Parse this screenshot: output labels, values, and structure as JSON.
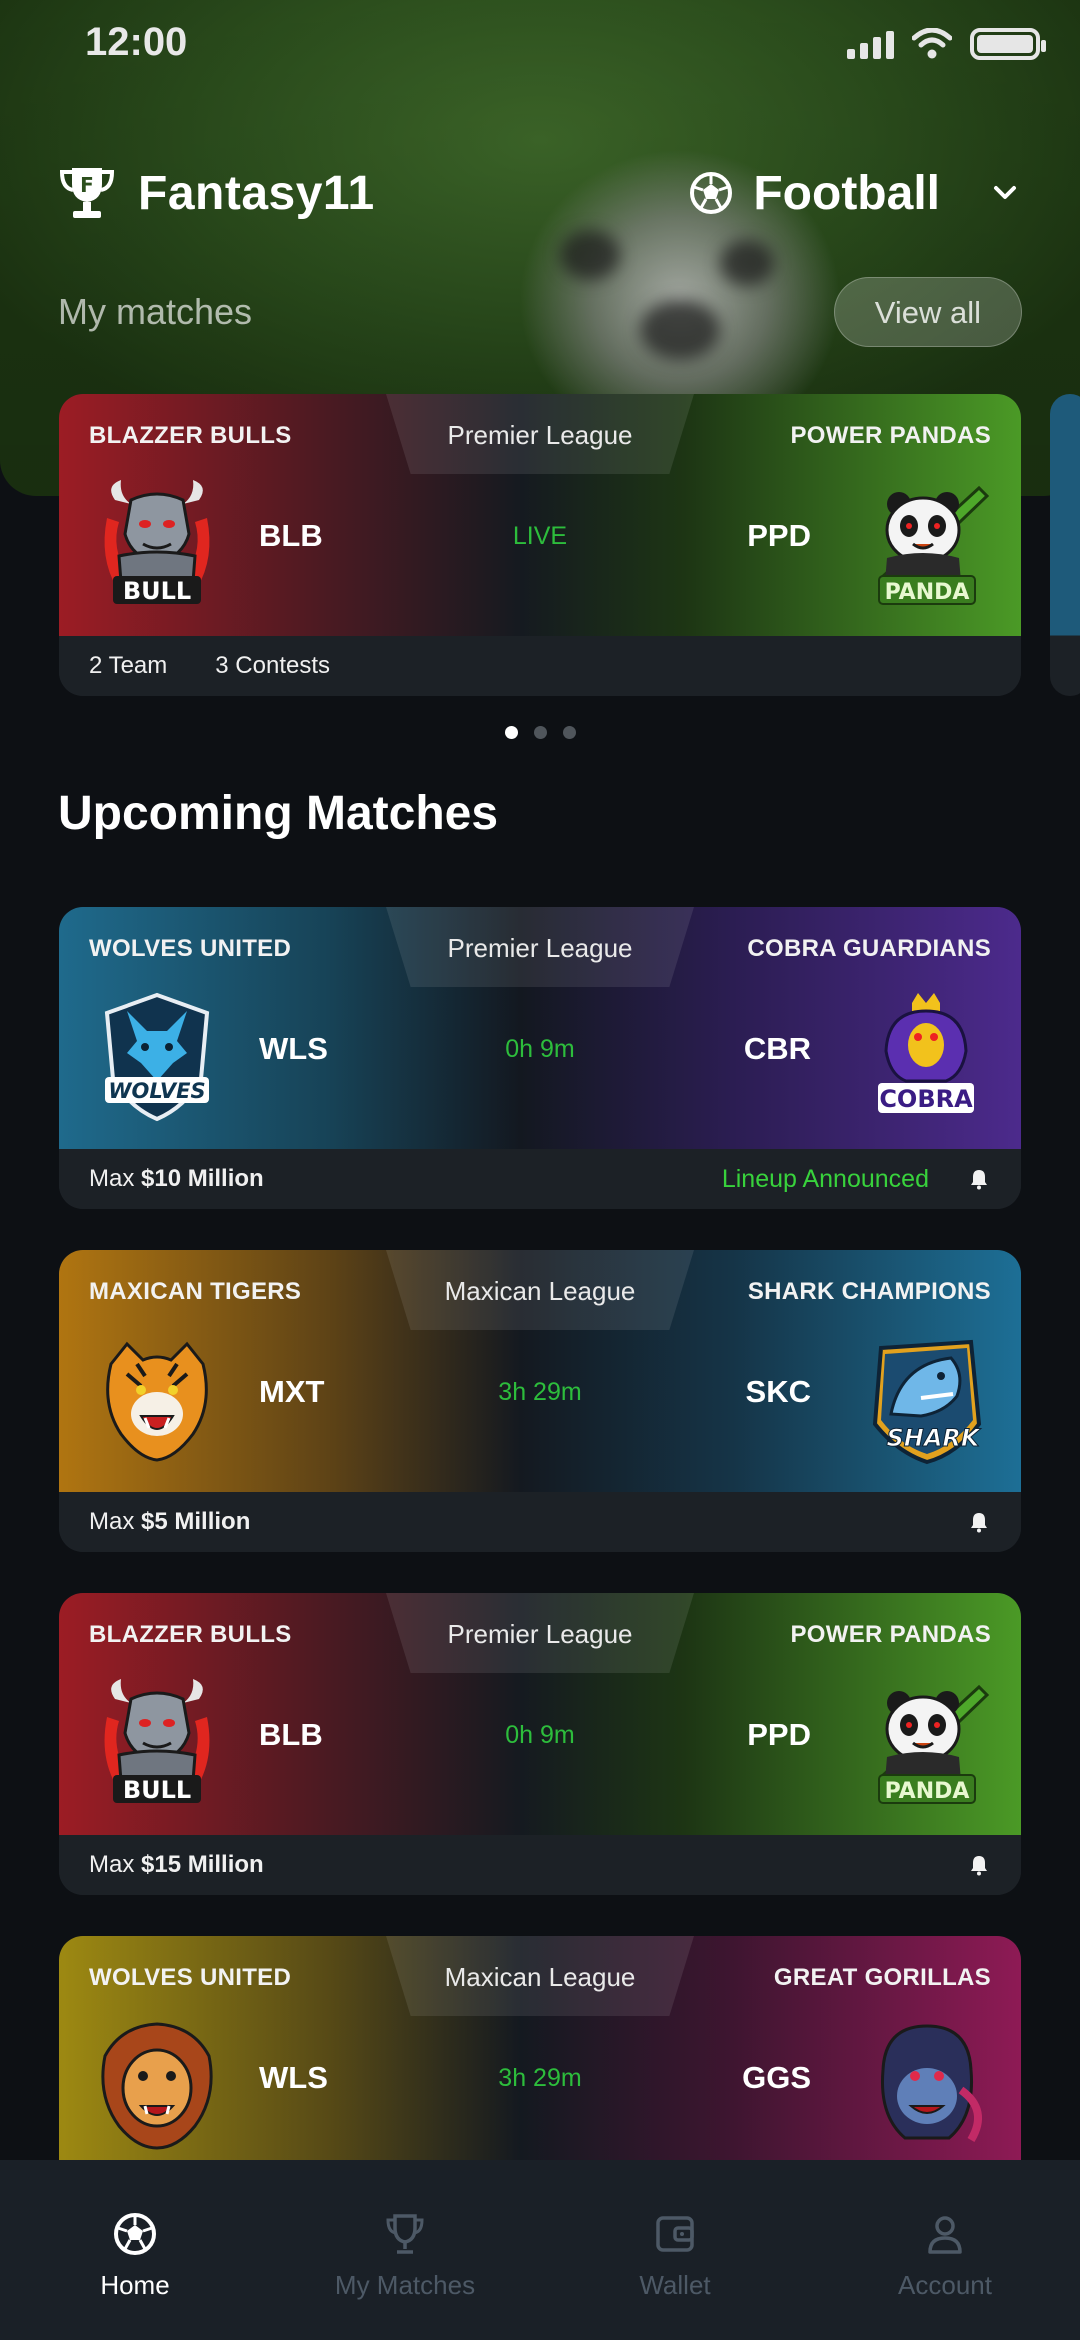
{
  "status_bar": {
    "time": "12:00"
  },
  "app": {
    "name": "Fantasy11",
    "sport": "Football"
  },
  "my_matches": {
    "title": "My matches",
    "view_all": "View all",
    "card": {
      "league": "Premier League",
      "team_left": {
        "name": "BLAZZER BULLS",
        "code": "BLB",
        "logo": "bull-logo"
      },
      "team_right": {
        "name": "POWER PANDAS",
        "code": "PPD",
        "logo": "panda-logo"
      },
      "status": "LIVE",
      "teams_count": "2 Team",
      "contests_count": "3 Contests"
    },
    "carousel_index": 0,
    "carousel_total": 3
  },
  "upcoming": {
    "title": "Upcoming Matches",
    "matches": [
      {
        "league": "Premier League",
        "team_left": {
          "name": "WOLVES UNITED",
          "code": "WLS",
          "logo": "wolves-logo"
        },
        "team_right": {
          "name": "COBRA GUARDIANS",
          "code": "CBR",
          "logo": "cobra-logo"
        },
        "time_left": "0h 9m",
        "max_prefix": "Max",
        "max_prize": "$10 Million",
        "lineup": "Lineup Announced"
      },
      {
        "league": "Maxican League",
        "team_left": {
          "name": "MAXICAN TIGERS",
          "code": "MXT",
          "logo": "tiger-logo"
        },
        "team_right": {
          "name": "SHARK CHAMPIONS",
          "code": "SKC",
          "logo": "shark-logo"
        },
        "time_left": "3h 29m",
        "max_prefix": "Max",
        "max_prize": "$5 Million"
      },
      {
        "league": "Premier League",
        "team_left": {
          "name": "BLAZZER BULLS",
          "code": "BLB",
          "logo": "bull-logo"
        },
        "team_right": {
          "name": "POWER PANDAS",
          "code": "PPD",
          "logo": "panda-logo"
        },
        "time_left": "0h 9m",
        "max_prefix": "Max",
        "max_prize": "$15 Million"
      },
      {
        "league": "Maxican League",
        "team_left": {
          "name": "WOLVES UNITED",
          "code": "WLS",
          "logo": "lion-logo"
        },
        "team_right": {
          "name": "GREAT GORILLAS",
          "code": "GGS",
          "logo": "gorilla-logo"
        },
        "time_left": "3h 29m"
      }
    ]
  },
  "nav": {
    "items": [
      {
        "label": "Home",
        "icon": "football-icon",
        "active": true
      },
      {
        "label": "My Matches",
        "icon": "trophy-icon",
        "active": false
      },
      {
        "label": "Wallet",
        "icon": "wallet-icon",
        "active": false
      },
      {
        "label": "Account",
        "icon": "user-icon",
        "active": false
      }
    ]
  },
  "colors": {
    "live_green": "#2dbd3c",
    "lineup_green": "#38d23c",
    "background": "#0d1014",
    "card_footer": "#1c2126",
    "nav_background": "#1a2027",
    "nav_inactive": "#4d5966"
  }
}
